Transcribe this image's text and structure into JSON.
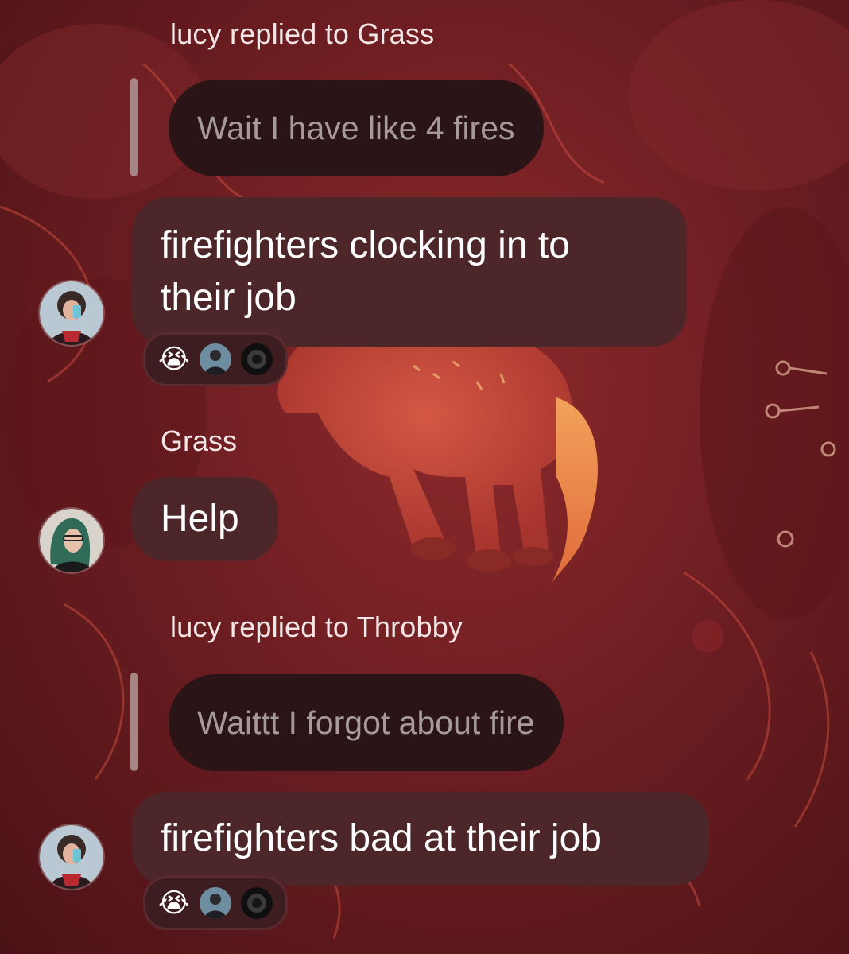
{
  "messages": [
    {
      "reply_label": "lucy replied to Grass",
      "quoted_text": "Wait I have like 4 fires",
      "body_line1": "firefighters clocking in to",
      "body_line2": "their job",
      "reactions": {
        "emoji": "😭",
        "avatars": [
          "reactor-avatar",
          "reactor-avatar-dark"
        ]
      }
    },
    {
      "sender": "Grass",
      "body": "Help"
    },
    {
      "reply_label": "lucy replied to Throbby",
      "quoted_text": "Waittt I forgot about fire",
      "body": "firefighters bad at their job",
      "reactions": {
        "emoji": "😭",
        "avatars": [
          "reactor-avatar",
          "reactor-avatar-dark"
        ]
      }
    }
  ],
  "colors": {
    "background": "#6e1e22",
    "bubble": "#4c2629",
    "quote_bubble": "#2b1416",
    "quote_text": "#a79a9a"
  }
}
